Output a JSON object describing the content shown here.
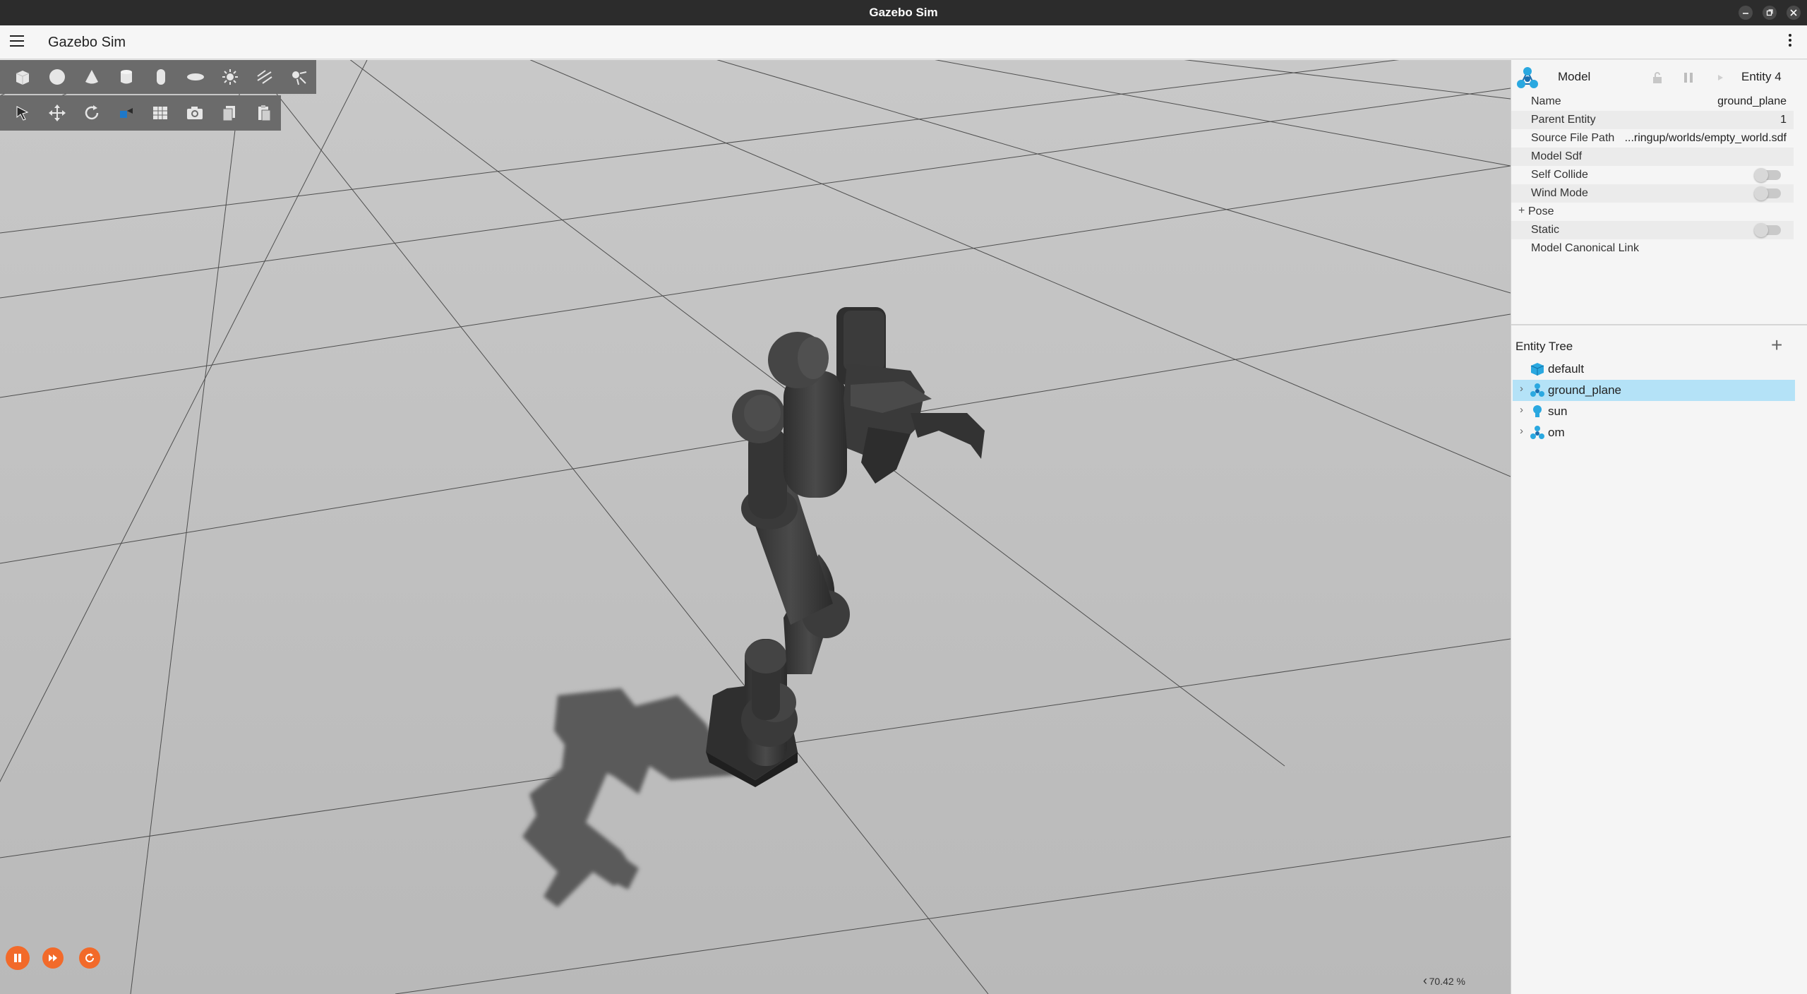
{
  "window": {
    "title": "Gazebo Sim"
  },
  "app": {
    "title": "Gazebo Sim",
    "menu_icon": "hamburger-icon",
    "more_icon": "kebab-icon"
  },
  "toolbar": {
    "shapes": [
      "box-icon",
      "sphere-icon",
      "cone-icon",
      "cylinder-icon",
      "capsule-icon",
      "ellipsoid-icon",
      "sun-light-icon",
      "directional-light-icon",
      "spot-light-icon"
    ],
    "tools": [
      "select-icon",
      "translate-icon",
      "rotate-icon",
      "transform-icon",
      "grid-icon",
      "camera-icon",
      "copy-icon",
      "paste-icon"
    ]
  },
  "component_inspector": {
    "type_label": "Model",
    "entity_label": "Entity 4",
    "properties": [
      {
        "key": "Name",
        "value": "ground_plane"
      },
      {
        "key": "Parent Entity",
        "value": "1"
      },
      {
        "key": "Source File Path",
        "value": "...ringup/worlds/empty_world.sdf"
      },
      {
        "key": "Model Sdf",
        "value": ""
      },
      {
        "key": "Self Collide",
        "value": ""
      },
      {
        "key": "Wind Mode",
        "value": ""
      },
      {
        "key": "Pose",
        "value": ""
      },
      {
        "key": "Static",
        "value": ""
      },
      {
        "key": "Model Canonical Link",
        "value": ""
      }
    ],
    "pose_expander": "+"
  },
  "entity_tree": {
    "title": "Entity Tree",
    "add_label": "+",
    "items": [
      {
        "name": "default",
        "icon": "world-cube-icon",
        "expandable": false,
        "selected": false
      },
      {
        "name": "ground_plane",
        "icon": "model-icon",
        "expandable": true,
        "selected": true
      },
      {
        "name": "sun",
        "icon": "light-bulb-icon",
        "expandable": true,
        "selected": false
      },
      {
        "name": "om",
        "icon": "model-icon",
        "expandable": true,
        "selected": false
      }
    ]
  },
  "playback": {
    "pause_icon": "pause-icon",
    "step_icon": "fast-forward-icon",
    "reset_icon": "reset-icon"
  },
  "stats": {
    "real_time_factor": "70.42 %",
    "collapse_icon": "chevron-left-icon"
  },
  "colors": {
    "accent": "#f26a2a",
    "selection": "#b4e2f7",
    "ground": "#bdbdbd",
    "robot": "#3f3f3f",
    "shadow": "#5c5c5c"
  }
}
